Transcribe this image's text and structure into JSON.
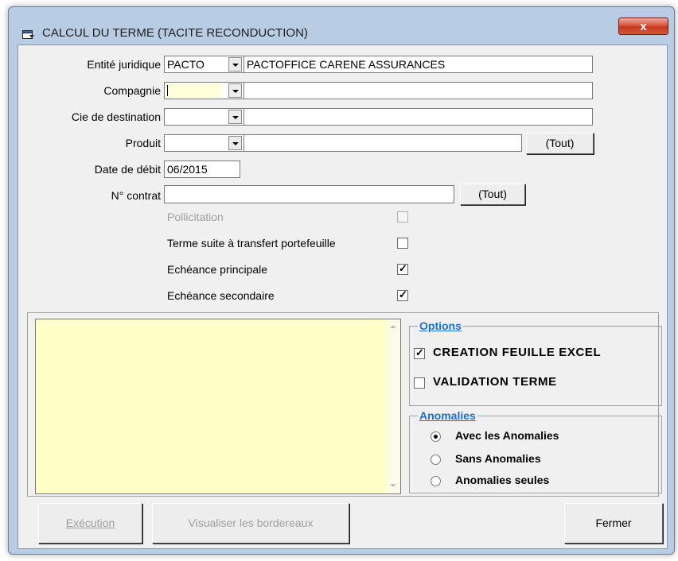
{
  "window": {
    "title": "CALCUL DU TERME (TACITE RECONDUCTION)",
    "close_label": "x"
  },
  "form": {
    "entite_label": "Entité juridique",
    "entite_code": "PACTO",
    "entite_name": "PACTOFFICE CARENE ASSURANCES",
    "compagnie_label": "Compagnie",
    "compagnie_value": "",
    "cie_dest_label": "Cie de destination",
    "produit_label": "Produit",
    "produit_tout": "(Tout)",
    "date_label": "Date de débit",
    "date_value": "06/2015",
    "contrat_label": "N° contrat",
    "contrat_value": "",
    "contrat_tout": "(Tout)",
    "checks": {
      "pollicitation": {
        "label": "Pollicitation",
        "checked": false,
        "enabled": false
      },
      "transfert": {
        "label": "Terme suite à transfert portefeuille",
        "checked": false,
        "enabled": true
      },
      "principale": {
        "label": "Echéance principale",
        "checked": true,
        "enabled": true
      },
      "secondaire": {
        "label": "Echéance secondaire",
        "checked": true,
        "enabled": true
      }
    }
  },
  "options": {
    "title": "Options",
    "excel_label": "CREATION FEUILLE EXCEL",
    "excel_checked": true,
    "validation_label": "VALIDATION TERME",
    "validation_checked": false
  },
  "anomalies": {
    "title": "Anomalies",
    "avec_label": "Avec les Anomalies",
    "sans_label": "Sans Anomalies",
    "seules_label": "Anomalies seules",
    "selected": "avec"
  },
  "buttons": {
    "execution": "Exécution",
    "visualiser": "Visualiser les bordereaux",
    "fermer": "Fermer"
  },
  "colors": {
    "log_bg": "#ffffc8",
    "compagnie_focus_bg": "#ffffd9",
    "group_title": "#1a6fd6"
  }
}
